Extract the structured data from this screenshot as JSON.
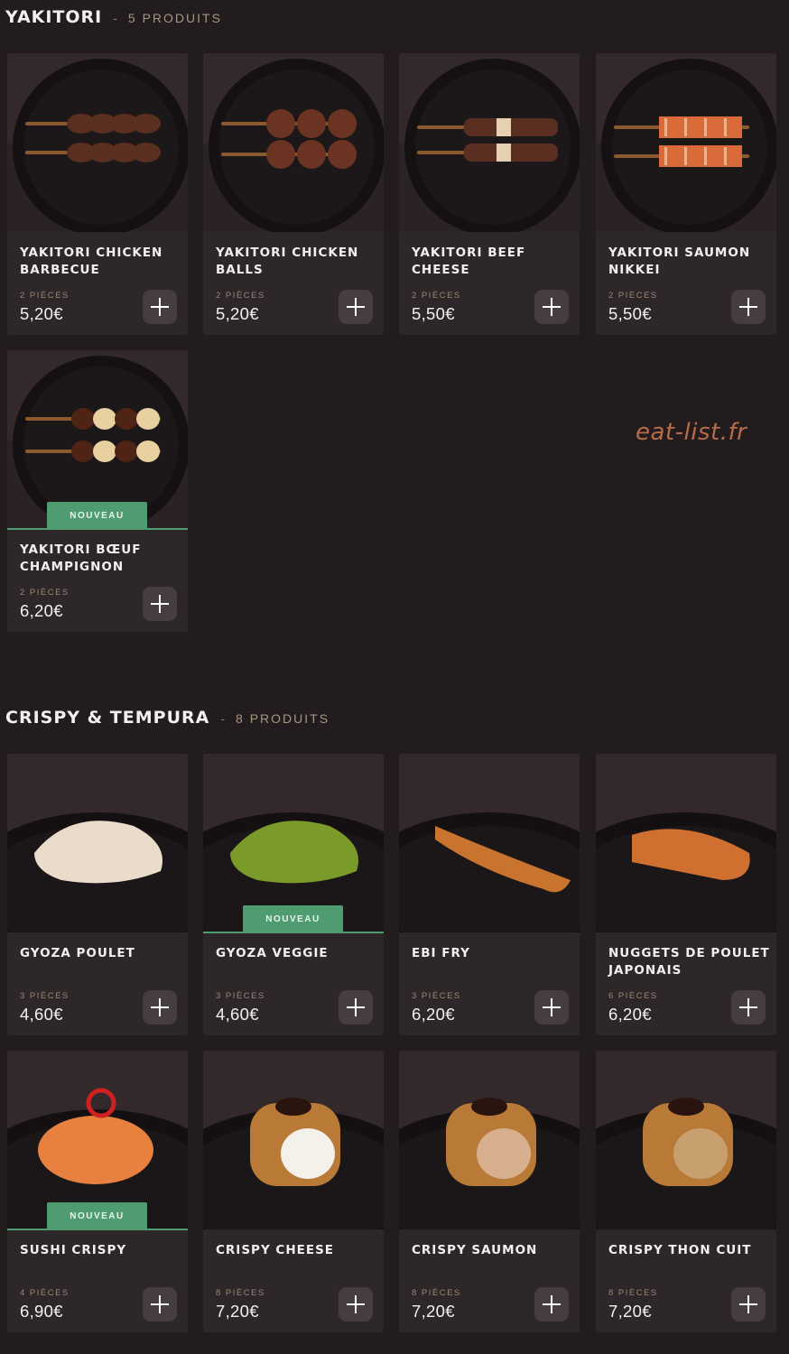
{
  "watermark": "eat-list.fr",
  "sections": [
    {
      "title": "YAKITORI",
      "separator": "-",
      "count": "5 PRODUITS",
      "items": [
        {
          "name": "YAKITORI CHICKEN BARBECUE",
          "pieces": "2 PIÈCES",
          "price": "5,20€",
          "badge": "",
          "image": "yakitori-chicken-skewers"
        },
        {
          "name": "YAKITORI CHICKEN BALLS",
          "pieces": "2 PIÈCES",
          "price": "5,20€",
          "badge": "",
          "image": "yakitori-chicken-balls"
        },
        {
          "name": "YAKITORI BEEF CHEESE",
          "pieces": "2 PIÈCES",
          "price": "5,50€",
          "badge": "",
          "image": "yakitori-beef-cheese"
        },
        {
          "name": "YAKITORI SAUMON NIKKEI",
          "pieces": "2 PIÈCES",
          "price": "5,50€",
          "badge": "",
          "image": "yakitori-salmon"
        },
        {
          "name": "YAKITORI BŒUF CHAMPIGNON",
          "pieces": "2 PIÈCES",
          "price": "6,20€",
          "badge": "NOUVEAU",
          "image": "yakitori-beef-mushroom"
        }
      ]
    },
    {
      "title": "CRISPY & TEMPURA",
      "separator": "-",
      "count": "8 PRODUITS",
      "items": [
        {
          "name": "GYOZA POULET",
          "pieces": "3 PIÈCES",
          "price": "4,60€",
          "badge": "",
          "image": "gyoza-chicken"
        },
        {
          "name": "GYOZA VEGGIE",
          "pieces": "3 PIÈCES",
          "price": "4,60€",
          "badge": "NOUVEAU",
          "image": "gyoza-veggie"
        },
        {
          "name": "EBI FRY",
          "pieces": "3 PIÈCES",
          "price": "6,20€",
          "badge": "",
          "image": "ebi-fry"
        },
        {
          "name": "NUGGETS DE POULET JAPONAIS",
          "pieces": "6 PIÈCES",
          "price": "6,20€",
          "badge": "",
          "image": "chicken-nuggets"
        },
        {
          "name": "SUSHI CRISPY",
          "pieces": "4 PIÈCES",
          "price": "6,90€",
          "badge": "NOUVEAU",
          "image": "sushi-crispy"
        },
        {
          "name": "CRISPY CHEESE",
          "pieces": "8 PIÈCES",
          "price": "7,20€",
          "badge": "",
          "image": "crispy-roll-cheese"
        },
        {
          "name": "CRISPY SAUMON",
          "pieces": "8 PIÈCES",
          "price": "7,20€",
          "badge": "",
          "image": "crispy-roll-salmon"
        },
        {
          "name": "CRISPY THON CUIT",
          "pieces": "8 PIÈCES",
          "price": "7,20€",
          "badge": "",
          "image": "crispy-roll-tuna"
        }
      ]
    }
  ]
}
